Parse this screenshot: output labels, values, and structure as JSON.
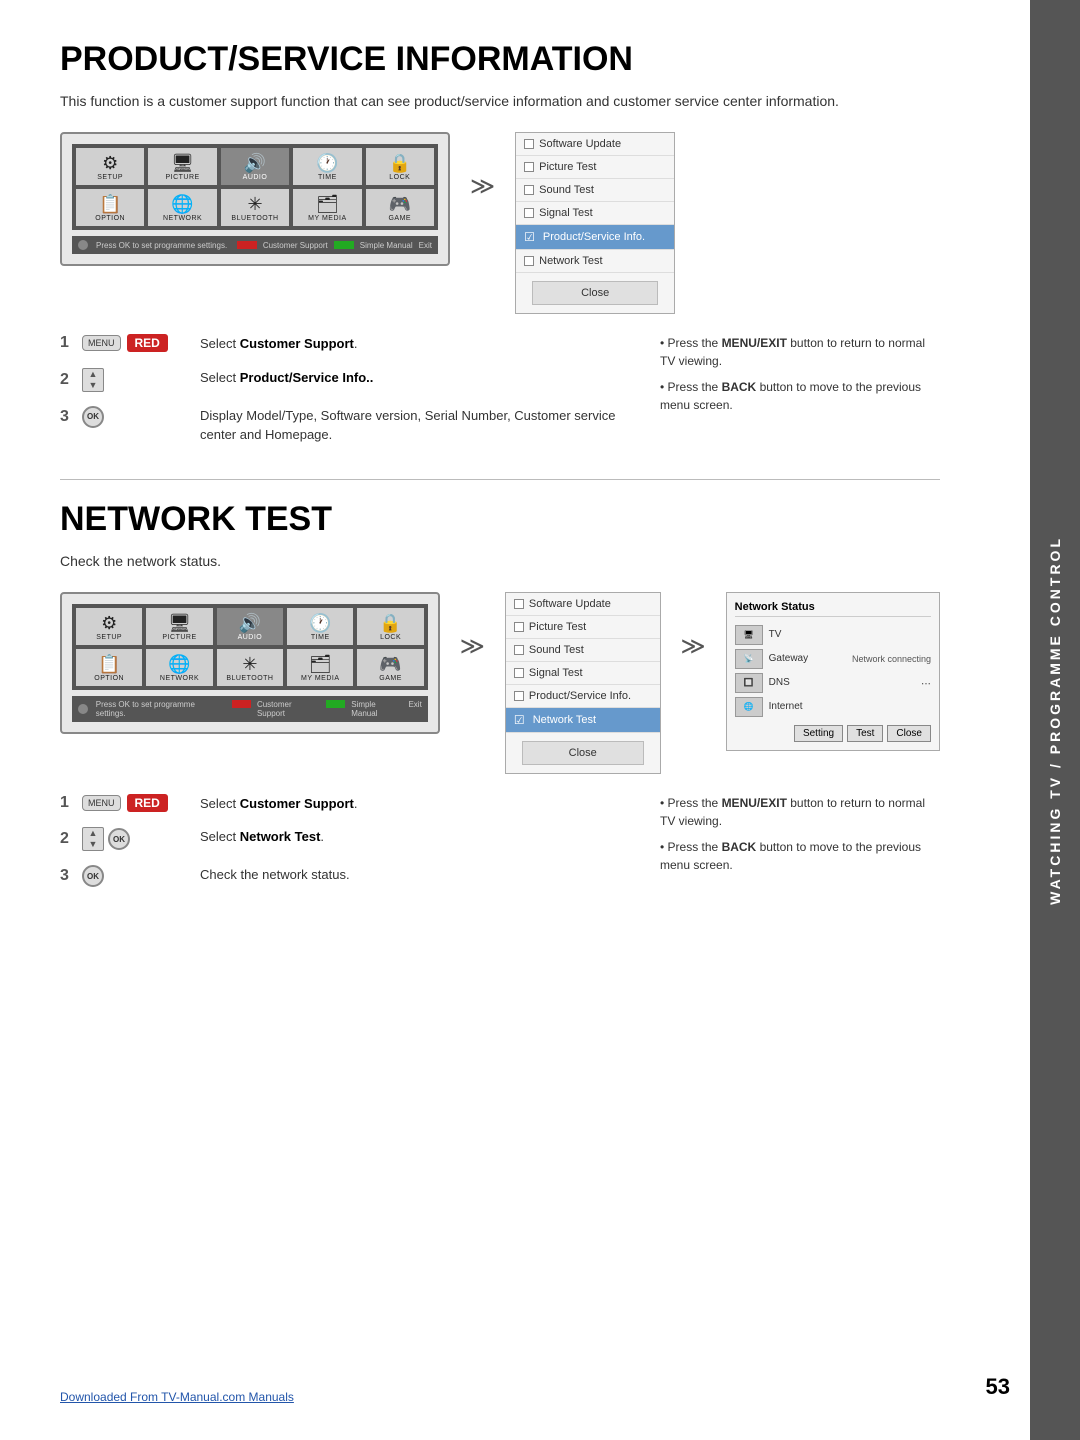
{
  "page": {
    "number": "53",
    "side_label": "WATCHING TV / PROGRAMME CONTROL"
  },
  "section1": {
    "title": "PRODUCT/SERVICE INFORMATION",
    "description": "This function is a customer support function that can see product/service information and customer service center information.",
    "tv_menu_items": [
      {
        "label": "SETUP",
        "icon": "⚙"
      },
      {
        "label": "PICTURE",
        "icon": "🖥"
      },
      {
        "label": "AUDIO",
        "icon": "🔊"
      },
      {
        "label": "TIME",
        "icon": "🕐"
      },
      {
        "label": "LOCK",
        "icon": "🔒"
      },
      {
        "label": "OPTION",
        "icon": "📋"
      },
      {
        "label": "NETWORK",
        "icon": "🌐"
      },
      {
        "label": "BLUETOOTH",
        "icon": "✳"
      },
      {
        "label": "MY MEDIA",
        "icon": "🗂"
      },
      {
        "label": "GAME",
        "icon": "🎮"
      }
    ],
    "side_menu": {
      "items": [
        {
          "label": "Software Update",
          "checked": false,
          "highlighted": false
        },
        {
          "label": "Picture Test",
          "checked": false,
          "highlighted": false
        },
        {
          "label": "Sound Test",
          "checked": false,
          "highlighted": false
        },
        {
          "label": "Signal Test",
          "checked": false,
          "highlighted": false
        },
        {
          "label": "Product/Service Info.",
          "checked": true,
          "highlighted": true
        },
        {
          "label": "Network Test",
          "checked": false,
          "highlighted": false
        }
      ],
      "close_label": "Close"
    },
    "steps": [
      {
        "num": "1",
        "button": "MENU",
        "badge": "RED",
        "text": "Select <strong>Customer Support</strong>."
      },
      {
        "num": "2",
        "type": "arrows",
        "text": "Select <strong>Product/Service Info.</strong>."
      },
      {
        "num": "3",
        "type": "ok",
        "text": "Display Model/Type, Software version, Serial Number, Customer service center and Homepage."
      }
    ],
    "tips": [
      "• Press the <strong>MENU/EXIT</strong> button to return to normal TV viewing.",
      "• Press the <strong>BACK</strong> button to move to the previous menu screen."
    ]
  },
  "section2": {
    "title": "NETWORK TEST",
    "description": "Check the network status.",
    "tv_menu_items": [
      {
        "label": "SETUP",
        "icon": "⚙"
      },
      {
        "label": "PICTURE",
        "icon": "🖥"
      },
      {
        "label": "AUDIO",
        "icon": "🔊"
      },
      {
        "label": "TIME",
        "icon": "🕐"
      },
      {
        "label": "LOCK",
        "icon": "🔒"
      },
      {
        "label": "OPTION",
        "icon": "📋"
      },
      {
        "label": "NETWORK",
        "icon": "🌐"
      },
      {
        "label": "BLUETOOTH",
        "icon": "✳"
      },
      {
        "label": "MY MEDIA",
        "icon": "🗂"
      },
      {
        "label": "GAME",
        "icon": "🎮"
      }
    ],
    "side_menu": {
      "items": [
        {
          "label": "Software Update",
          "checked": false,
          "highlighted": false
        },
        {
          "label": "Picture Test",
          "checked": false,
          "highlighted": false
        },
        {
          "label": "Sound Test",
          "checked": false,
          "highlighted": false
        },
        {
          "label": "Signal Test",
          "checked": false,
          "highlighted": false
        },
        {
          "label": "Product/Service Info.",
          "checked": false,
          "highlighted": false
        },
        {
          "label": "Network Test",
          "checked": true,
          "highlighted": true
        }
      ],
      "close_label": "Close"
    },
    "network_status": {
      "title": "Network Status",
      "tv_label": "TV",
      "gateway_label": "Gateway",
      "dns_label": "DNS",
      "internet_label": "Internet",
      "connecting_label": "Network connecting",
      "buttons": [
        "Setting",
        "Test",
        "Close"
      ]
    },
    "steps": [
      {
        "num": "1",
        "button": "MENU",
        "badge": "RED",
        "text": "Select <strong>Customer Support</strong>."
      },
      {
        "num": "2",
        "type": "ok",
        "text": "Select <strong>Network Test</strong>."
      },
      {
        "num": "3",
        "type": "ok",
        "text": "Check the network status."
      }
    ],
    "tips": [
      "• Press the <strong>MENU/EXIT</strong> button to return to normal TV viewing.",
      "• Press the <strong>BACK</strong> button to move to the previous menu screen."
    ]
  },
  "footer": {
    "link_text": "Downloaded From TV-Manual.com Manuals"
  },
  "labels": {
    "customer_support": "Customer Support",
    "product_service_info": "Product/Service Info..",
    "display_model": "Display Model/Type, Software version, Serial Number, Customer service center and Homepage.",
    "select_network_test": "Select Network Test.",
    "check_network": "Check the network status.",
    "press_ok_label": "Press OK to set programme settings.",
    "customer_support_bar": "Customer Support",
    "simple_manual_bar": "Simple Manual",
    "exit_bar": "Exit",
    "menu_btn": "MENU",
    "ok_btn": "OK"
  }
}
